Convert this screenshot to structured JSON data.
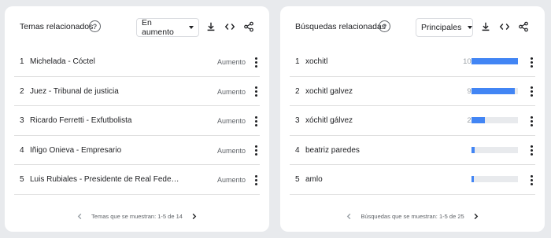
{
  "left_panel": {
    "title": "Temas relacionados",
    "filter_selected": "En aumento",
    "rows": [
      {
        "rank": "1",
        "label": "Michelada - Cóctel",
        "value": "Aumento"
      },
      {
        "rank": "2",
        "label": "Juez - Tribunal de justicia",
        "value": "Aumento"
      },
      {
        "rank": "3",
        "label": "Ricardo Ferretti - Exfutbolista",
        "value": "Aumento"
      },
      {
        "rank": "4",
        "label": "Íñigo Onieva - Empresario",
        "value": "Aumento"
      },
      {
        "rank": "5",
        "label": "Luis Rubiales - Presidente de Real Federaci...",
        "value": "Aumento"
      }
    ],
    "pager_text": "Temas que se muestran: 1-5 de 14"
  },
  "right_panel": {
    "title": "Búsquedas relacionadas",
    "filter_selected": "Principales",
    "rows": [
      {
        "rank": "1",
        "label": "xochitl",
        "value": "100",
        "level": 100
      },
      {
        "rank": "2",
        "label": "xochitl galvez",
        "value": "93",
        "level": 93
      },
      {
        "rank": "3",
        "label": "xóchitl gálvez",
        "value": "28",
        "level": 28
      },
      {
        "rank": "4",
        "label": "beatriz paredes",
        "value": "7",
        "level": 7
      },
      {
        "rank": "5",
        "label": "amlo",
        "value": "5",
        "level": 5
      }
    ],
    "pager_text": "Búsquedas que se muestran: 1-5 de 25"
  },
  "icons": {
    "help": "help-circle-icon",
    "download": "download-icon",
    "embed": "code-embed-icon",
    "share": "share-icon",
    "more": "more-vertical-icon",
    "prev": "chevron-left-icon",
    "next": "chevron-right-icon"
  },
  "colors": {
    "bar": "#4285f4",
    "bar_track": "#e8eaed",
    "background": "#e8eaed",
    "card": "#ffffff"
  }
}
